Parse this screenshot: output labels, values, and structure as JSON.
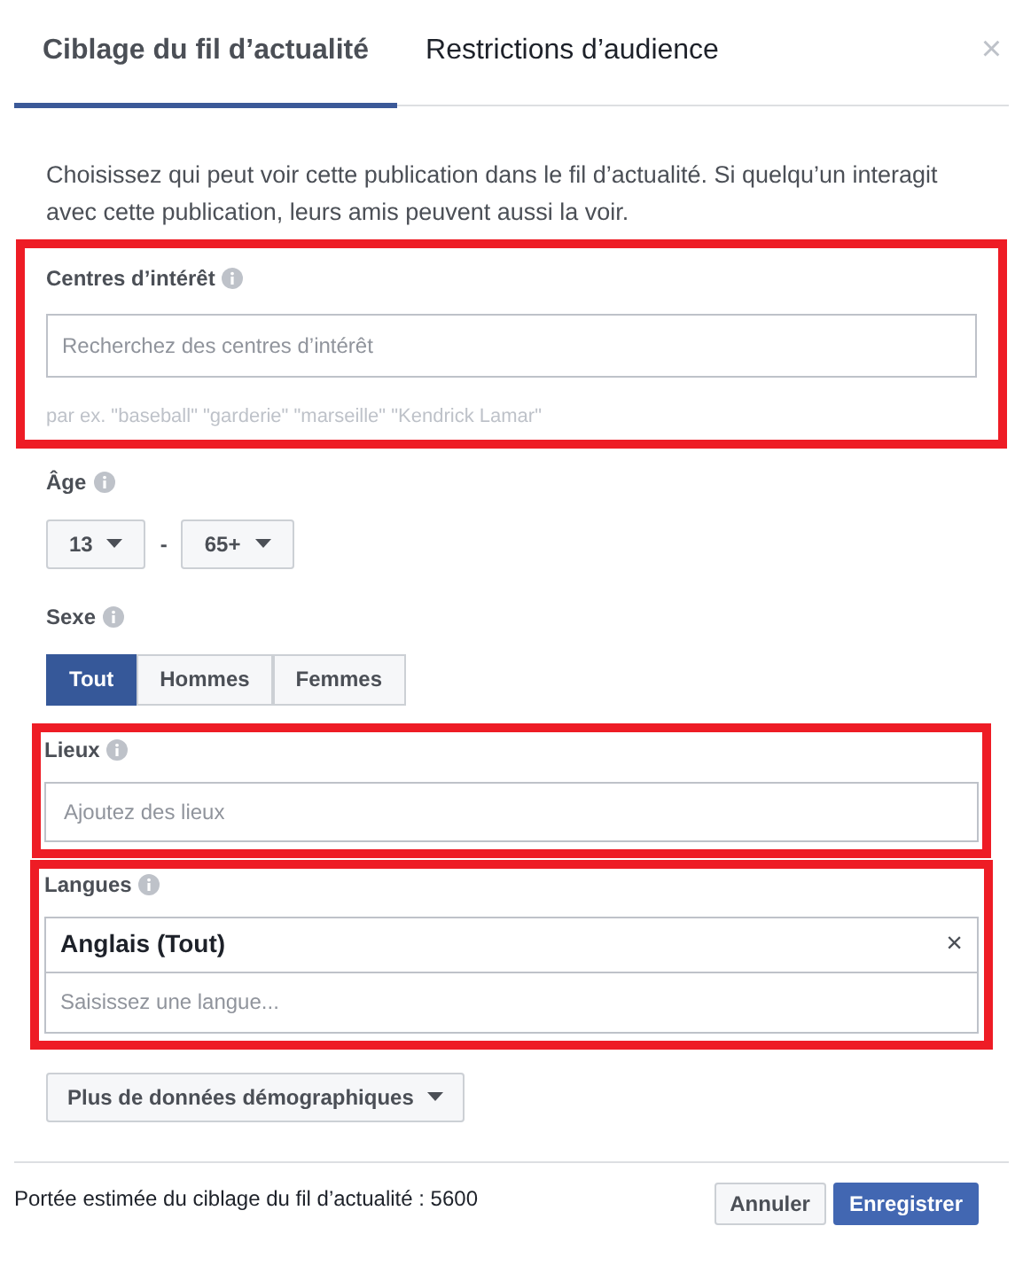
{
  "tabs": [
    {
      "label": "Ciblage du fil d’actualité",
      "selected": true
    },
    {
      "label": "Restrictions d’audience",
      "selected": false
    }
  ],
  "close": "×",
  "description": "Choisissez qui peut voir cette publication dans le fil d’actualité. Si quelqu’un interagit avec cette publication, leurs amis peuvent aussi la voir.",
  "interests": {
    "label": "Centres d’intérêt",
    "placeholder": "Recherchez des centres d’intérêt",
    "hint": "par ex. \"baseball\" \"garderie\" \"marseille\" \"Kendrick Lamar\"",
    "highlighted": true
  },
  "age": {
    "label": "Âge",
    "from": "13",
    "separator": "-",
    "to": "65+"
  },
  "gender": {
    "label": "Sexe",
    "options": [
      {
        "label": "Tout",
        "selected": true
      },
      {
        "label": "Hommes",
        "selected": false
      },
      {
        "label": "Femmes",
        "selected": false
      }
    ]
  },
  "locations": {
    "label": "Lieux",
    "placeholder": "Ajoutez des lieux",
    "highlighted": true
  },
  "languages": {
    "label": "Langues",
    "tokens": [
      {
        "label": "Anglais (Tout)",
        "remove": "×"
      }
    ],
    "placeholder": "Saisissez une langue...",
    "highlighted": true
  },
  "more_button": "Plus de données démographiques",
  "footer": {
    "reach": "Portée estimée du ciblage du fil d’actualité : 5600",
    "buttons": [
      {
        "label": "Annuler",
        "kind": "secondary"
      },
      {
        "label": "Enregistrer",
        "kind": "primary"
      }
    ]
  }
}
